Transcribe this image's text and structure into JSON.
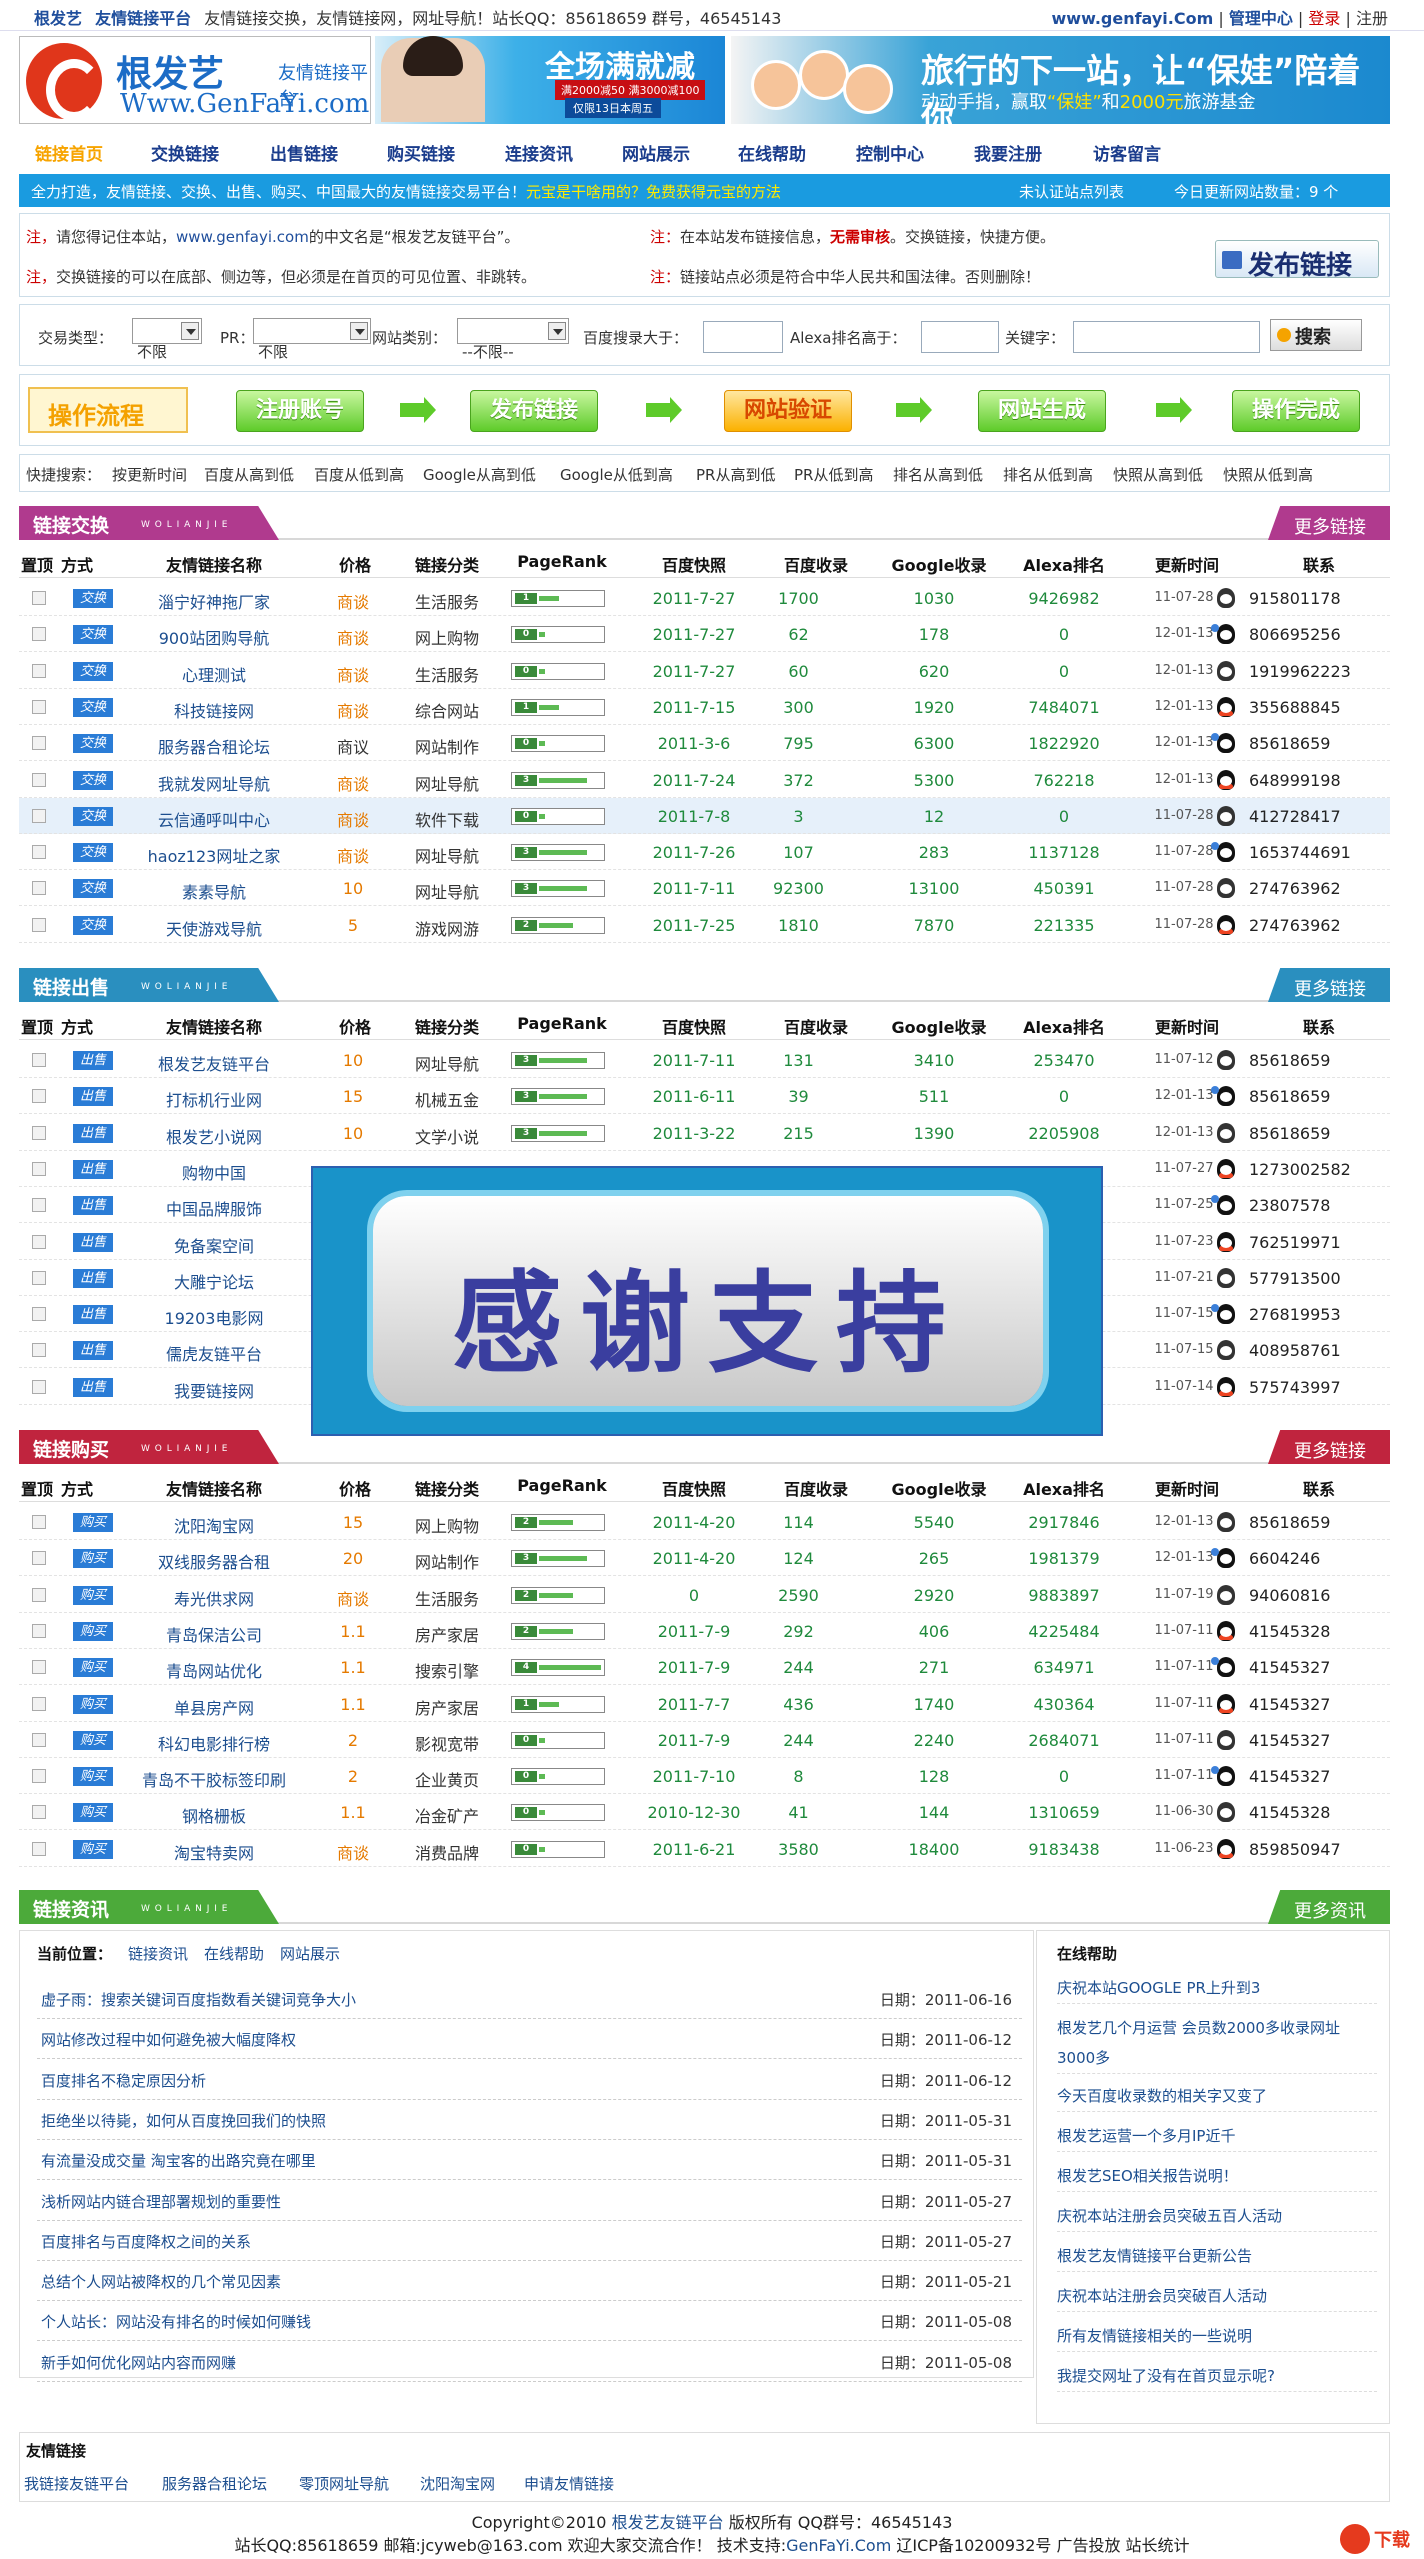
{
  "topbar": {
    "site": "根发艺",
    "sub": "友情链接平台",
    "desc": "友情链接交换，友情链接网，网址导航！站长QQ：85618659 群号，46545143",
    "domain": "www.genfayi.Com",
    "admin": "管理中心",
    "login": "登录",
    "register": "注册"
  },
  "header": {
    "logo_title": "根发艺",
    "logo_sub": "友情链接平台",
    "logo_url": "Www.GenFaYi.com",
    "ad1_title": "全场满就减",
    "ad1_line1": "满2000减50  满3000减100",
    "ad1_line2": "仅限13日本周五",
    "ad2_title": "旅行的下一站，让“保娃”陪着你",
    "ad2_pre": "动动手指，赢取",
    "ad2_hl1": "“保娃”",
    "ad2_mid": "和",
    "ad2_hl2": "2000元",
    "ad2_post": "旅游基金"
  },
  "nav": [
    "链接首页",
    "交换链接",
    "出售链接",
    "购买链接",
    "连接资讯",
    "网站展示",
    "在线帮助",
    "控制中心",
    "我要注册",
    "访客留言"
  ],
  "bluebar": {
    "left": "全力打造，友情链接、交换、出售、购买、中国最大的友情链接交易平台！",
    "link": "元宝是干啥用的？免费获得元宝的方法",
    "unverified": "未认证站点列表",
    "today": "今日更新网站数量：9 个"
  },
  "notice": {
    "n1_a": "注，",
    "n1_b": "请您得记住本站，",
    "n1_c": "www.genfayi.com",
    "n1_d": "的中文名是“根发艺友链平台”。",
    "n2_a": "注，",
    "n2_b": "交换链接的可以在底部、侧边等，但必须是在首页的可见位置、非跳转。",
    "n3_a": "注：",
    "n3_b": "在本站发布链接信息，",
    "n3_c": "无需审核",
    "n3_d": "。交换链接，快捷方便。",
    "n4_a": "注：",
    "n4_b": "链接站点必须是符合中华人民共和国法律。否则删除！",
    "publish": "发布链接"
  },
  "search": {
    "type_label": "交易类型：",
    "type_value": "不限",
    "pr_label": "PR：",
    "pr_value": "不限",
    "cat_label": "网站类别：",
    "cat_value": "--不限--",
    "bd_label": "百度搜录大于：",
    "alexa_label": "Alexa排名高于：",
    "kw_label": "关键字：",
    "button": "搜索"
  },
  "flow": {
    "title": "操作流程",
    "steps": [
      "注册账号",
      "发布链接",
      "网站验证",
      "网站生成",
      "操作完成"
    ]
  },
  "quick": {
    "label": "快捷搜索：",
    "items": [
      "按更新时间",
      "百度从高到低",
      "百度从低到高",
      "Google从高到低",
      "Google从低到高",
      "PR从高到低",
      "PR从低到高",
      "排名从高到低",
      "排名从低到高",
      "快照从高到低",
      "快照从低到高"
    ]
  },
  "columns": [
    "置顶",
    "方式",
    "友情链接名称",
    "价格",
    "链接分类",
    "PageRank",
    "百度快照",
    "百度收录",
    "Google收录",
    "Alexa排名",
    "更新时间",
    "联系"
  ],
  "sections": [
    {
      "title": "链接交换",
      "en": "W  O L I A N  J I E",
      "more": "更多链接",
      "color": "#b03a8e",
      "badge": "交换",
      "rows": [
        {
          "name": "淄宁好神拖厂家",
          "price": "商谈",
          "cat": "生活服务",
          "pr": "1",
          "date": "2011-7-27",
          "bd": "1700",
          "gg": "1030",
          "ax": "9426982",
          "upd": "11-07-28",
          "qq": "915801178"
        },
        {
          "name": "900站团购导航",
          "price": "商谈",
          "cat": "网上购物",
          "pr": "0",
          "date": "2011-7-27",
          "bd": "62",
          "gg": "178",
          "ax": "0",
          "upd": "12-01-13",
          "qq": "806695256"
        },
        {
          "name": "心理测试",
          "price": "商谈",
          "cat": "生活服务",
          "pr": "0",
          "date": "2011-7-27",
          "bd": "60",
          "gg": "620",
          "ax": "0",
          "upd": "12-01-13",
          "qq": "1919962223"
        },
        {
          "name": "科技链接网",
          "price": "商谈",
          "cat": "综合网站",
          "pr": "1",
          "date": "2011-7-15",
          "bd": "300",
          "gg": "1920",
          "ax": "7484071",
          "upd": "12-01-13",
          "qq": "355688845"
        },
        {
          "name": "服务器合租论坛",
          "price": "商议",
          "cat": "网站制作",
          "pr": "0",
          "date": "2011-3-6",
          "bd": "795",
          "gg": "6300",
          "ax": "1822920",
          "upd": "12-01-13",
          "qq": "85618659"
        },
        {
          "name": "我就发网址导航",
          "price": "商谈",
          "cat": "网址导航",
          "pr": "3",
          "date": "2011-7-24",
          "bd": "372",
          "gg": "5300",
          "ax": "762218",
          "upd": "12-01-13",
          "qq": "648999198"
        },
        {
          "name": "云信通呼叫中心",
          "price": "商谈",
          "cat": "软件下载",
          "pr": "0",
          "date": "2011-7-8",
          "bd": "3",
          "gg": "12",
          "ax": "0",
          "upd": "11-07-28",
          "qq": "412728417"
        },
        {
          "name": "haoz123网址之家",
          "price": "商谈",
          "cat": "网址导航",
          "pr": "3",
          "date": "2011-7-26",
          "bd": "107",
          "gg": "283",
          "ax": "1137128",
          "upd": "11-07-28",
          "qq": "1653744691"
        },
        {
          "name": "素素导航",
          "price": "10",
          "cat": "网址导航",
          "pr": "3",
          "date": "2011-7-11",
          "bd": "92300",
          "gg": "13100",
          "ax": "450391",
          "upd": "11-07-28",
          "qq": "274763962"
        },
        {
          "name": "天使游戏导航",
          "price": "5",
          "cat": "游戏网游",
          "pr": "2",
          "date": "2011-7-25",
          "bd": "1810",
          "gg": "7870",
          "ax": "221335",
          "upd": "11-07-28",
          "qq": "274763962"
        }
      ]
    },
    {
      "title": "链接出售",
      "en": "W  O L I A N  J I E",
      "more": "更多链接",
      "color": "#2a8fbf",
      "badge": "出售",
      "rows": [
        {
          "name": "根发艺友链平台",
          "price": "10",
          "cat": "网址导航",
          "pr": "3",
          "date": "2011-7-11",
          "bd": "131",
          "gg": "3410",
          "ax": "253470",
          "upd": "11-07-12",
          "qq": "85618659"
        },
        {
          "name": "打标机行业网",
          "price": "15",
          "cat": "机械五金",
          "pr": "3",
          "date": "2011-6-11",
          "bd": "39",
          "gg": "511",
          "ax": "0",
          "upd": "12-01-13",
          "qq": "85618659"
        },
        {
          "name": "根发艺小说网",
          "price": "10",
          "cat": "文学小说",
          "pr": "3",
          "date": "2011-3-22",
          "bd": "215",
          "gg": "1390",
          "ax": "2205908",
          "upd": "12-01-13",
          "qq": "85618659"
        },
        {
          "name": "购物中国",
          "price": "",
          "cat": "",
          "pr": "",
          "date": "",
          "bd": "",
          "gg": "",
          "ax": "",
          "upd": "11-07-27",
          "qq": "1273002582"
        },
        {
          "name": "中国品牌服饰",
          "price": "",
          "cat": "",
          "pr": "",
          "date": "",
          "bd": "",
          "gg": "",
          "ax": "",
          "upd": "11-07-25",
          "qq": "23807578"
        },
        {
          "name": "免备案空间",
          "price": "",
          "cat": "",
          "pr": "",
          "date": "",
          "bd": "",
          "gg": "",
          "ax": "",
          "upd": "11-07-23",
          "qq": "762519971"
        },
        {
          "name": "大雕宁论坛",
          "price": "",
          "cat": "",
          "pr": "",
          "date": "",
          "bd": "",
          "gg": "",
          "ax": "",
          "upd": "11-07-21",
          "qq": "577913500"
        },
        {
          "name": "19203电影网",
          "price": "",
          "cat": "",
          "pr": "",
          "date": "",
          "bd": "",
          "gg": "",
          "ax": "",
          "upd": "11-07-15",
          "qq": "276819953"
        },
        {
          "name": "儒虎友链平台",
          "price": "",
          "cat": "",
          "pr": "",
          "date": "",
          "bd": "",
          "gg": "",
          "ax": "",
          "upd": "11-07-15",
          "qq": "408958761"
        },
        {
          "name": "我要链接网",
          "price": "",
          "cat": "",
          "pr": "",
          "date": "",
          "bd": "",
          "gg": "",
          "ax": "",
          "upd": "11-07-14",
          "qq": "575743997"
        }
      ]
    },
    {
      "title": "链接购买",
      "en": "W  O L I A N  J I E",
      "more": "更多链接",
      "color": "#c0243e",
      "badge": "购买",
      "rows": [
        {
          "name": "沈阳淘宝网",
          "price": "15",
          "cat": "网上购物",
          "pr": "2",
          "date": "2011-4-20",
          "bd": "114",
          "gg": "5540",
          "ax": "2917846",
          "upd": "12-01-13",
          "qq": "85618659"
        },
        {
          "name": "双线服务器合租",
          "price": "20",
          "cat": "网站制作",
          "pr": "3",
          "date": "2011-4-20",
          "bd": "124",
          "gg": "265",
          "ax": "1981379",
          "upd": "12-01-13",
          "qq": "6604246"
        },
        {
          "name": "寿光供求网",
          "price": "商谈",
          "cat": "生活服务",
          "pr": "2",
          "date": "0",
          "bd": "2590",
          "gg": "2920",
          "ax": "9883897",
          "upd": "11-07-19",
          "qq": "94060816"
        },
        {
          "name": "青岛保洁公司",
          "price": "1.1",
          "cat": "房产家居",
          "pr": "2",
          "date": "2011-7-9",
          "bd": "292",
          "gg": "406",
          "ax": "4225484",
          "upd": "11-07-11",
          "qq": "41545328"
        },
        {
          "name": "青岛网站优化",
          "price": "1.1",
          "cat": "搜索引擎",
          "pr": "4",
          "date": "2011-7-9",
          "bd": "244",
          "gg": "271",
          "ax": "634971",
          "upd": "11-07-11",
          "qq": "41545327"
        },
        {
          "name": "单县房产网",
          "price": "1.1",
          "cat": "房产家居",
          "pr": "1",
          "date": "2011-7-7",
          "bd": "436",
          "gg": "1740",
          "ax": "430364",
          "upd": "11-07-11",
          "qq": "41545327"
        },
        {
          "name": "科幻电影排行榜",
          "price": "2",
          "cat": "影视宽带",
          "pr": "0",
          "date": "2011-7-9",
          "bd": "244",
          "gg": "2240",
          "ax": "2684071",
          "upd": "11-07-11",
          "qq": "41545327"
        },
        {
          "name": "青岛不干胶标签印刷",
          "price": "2",
          "cat": "企业黄页",
          "pr": "0",
          "date": "2011-7-10",
          "bd": "8",
          "gg": "128",
          "ax": "0",
          "upd": "11-07-11",
          "qq": "41545327"
        },
        {
          "name": "钢格栅板",
          "price": "1.1",
          "cat": "冶金矿产",
          "pr": "0",
          "date": "2010-12-30",
          "bd": "41",
          "gg": "144",
          "ax": "1310659",
          "upd": "11-06-30",
          "qq": "41545328"
        },
        {
          "name": "淘宝特卖网",
          "price": "商谈",
          "cat": "消费品牌",
          "pr": "0",
          "date": "2011-6-21",
          "bd": "3580",
          "gg": "18400",
          "ax": "9183438",
          "upd": "11-06-23",
          "qq": "859850947"
        }
      ]
    }
  ],
  "overlay_text": "感谢支持",
  "news_section": {
    "title": "链接资讯",
    "en": "W  O L I A N  J I E",
    "more": "更多资讯",
    "color": "#4caa3a",
    "pos_label": "当前位置：",
    "pos_links": [
      "链接资讯",
      "在线帮助",
      "网站展示"
    ],
    "items": [
      {
        "t": "虚子雨：搜索关键词百度指数看关键词竞争大小",
        "d": "日期：2011-06-16"
      },
      {
        "t": "网站修改过程中如何避免被大幅度降权",
        "d": "日期：2011-06-12"
      },
      {
        "t": "百度排名不稳定原因分析",
        "d": "日期：2011-06-12"
      },
      {
        "t": "拒绝坐以待毙，如何从百度挽回我们的快照",
        "d": "日期：2011-05-31"
      },
      {
        "t": "有流量没成交量 淘宝客的出路究竟在哪里",
        "d": "日期：2011-05-31"
      },
      {
        "t": "浅析网站内链合理部署规划的重要性",
        "d": "日期：2011-05-27"
      },
      {
        "t": "百度排名与百度降权之间的关系",
        "d": "日期：2011-05-27"
      },
      {
        "t": "总结个人网站被降权的几个常见因素",
        "d": "日期：2011-05-21"
      },
      {
        "t": "个人站长：网站没有排名的时候如何赚钱",
        "d": "日期：2011-05-08"
      },
      {
        "t": "新手如何优化网站内容而网赚",
        "d": "日期：2011-05-08"
      }
    ],
    "help_title": "在线帮助",
    "help": [
      "庆祝本站GOOGLE PR上升到3",
      "根发艺几个月运营 会员数2000多收录网址3000多",
      "今天百度收录数的相关字又变了",
      "根发艺运营一个多月IP近千",
      "根发艺SEO相关报告说明！",
      "庆祝本站注册会员突破五百人活动",
      "根发艺友情链接平台更新公告",
      "庆祝本站注册会员突破百人活动",
      "所有友情链接相关的一些说明",
      "我提交网址了没有在首页显示呢?"
    ]
  },
  "friends": {
    "title": "友情链接",
    "items": [
      "我链接友链平台",
      "服务器合租论坛",
      "零顶网址导航",
      "沈阳淘宝网",
      "申请友情链接"
    ]
  },
  "footer": {
    "line1_a": "Copyright©2010",
    "line1_b": "根发艺友链平台",
    "line1_c": "版权所有 QQ群号：46545143",
    "line2_a": "站长QQ:85618659 邮箱:jcyweb@163.com 欢迎大家交流合作！ 技术支持:",
    "line2_b": "GenFaYi.Com",
    "line2_c": "辽ICP备10200932号 广告投放 站长统计",
    "dl": "下载"
  }
}
